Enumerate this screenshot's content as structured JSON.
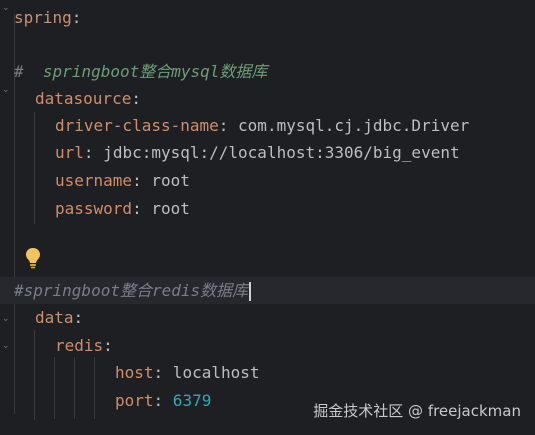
{
  "editor": {
    "lines": {
      "l1": {
        "key": "spring",
        "colon": ":"
      },
      "l3": {
        "hash": "#",
        "text": "  springboot整合mysql数据库"
      },
      "l4": {
        "key": "datasource",
        "colon": ":"
      },
      "l5": {
        "key": "driver-class-name",
        "colon": ":",
        "value": " com.mysql.cj.jdbc.Driver"
      },
      "l6": {
        "key": "url",
        "colon": ":",
        "value": " jdbc:mysql://localhost:3306/big_event"
      },
      "l7": {
        "key": "username",
        "colon": ":",
        "value": " root"
      },
      "l8": {
        "key": "password",
        "colon": ":",
        "value": " root"
      },
      "l10": {
        "text": "#springboot整合redis数据库"
      },
      "l11": {
        "key": "data",
        "colon": ":"
      },
      "l12": {
        "key": "redis",
        "colon": ":"
      },
      "l13": {
        "key": "host",
        "colon": ":",
        "value": " localhost"
      },
      "l14": {
        "key": "port",
        "colon": ":",
        "value": " 6379"
      }
    }
  },
  "icons": {
    "intention": "lightbulb-icon",
    "fold": "fold-chevron-icon"
  },
  "colors": {
    "background": "#1e1f22",
    "key": "#cf8e6d",
    "comment": "#7a7e85",
    "number": "#2aacb8"
  },
  "watermark": {
    "text": "掘金技术社区 @ freejackman"
  }
}
